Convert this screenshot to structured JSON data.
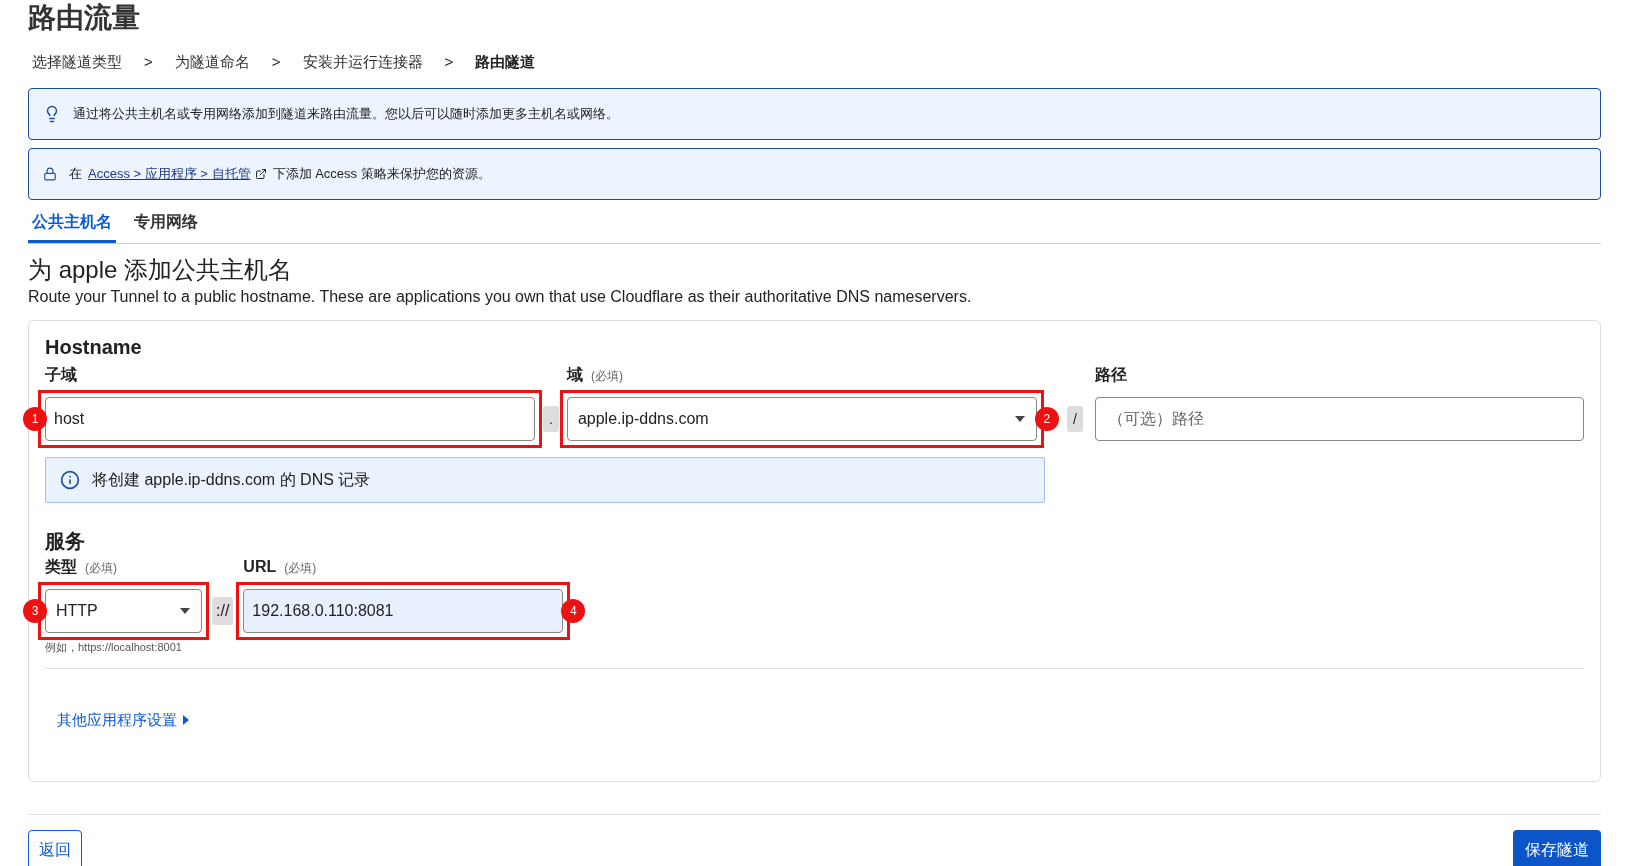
{
  "page_title": "路由流量",
  "breadcrumb": [
    {
      "label": "选择隧道类型",
      "selected": false
    },
    {
      "label": "为隧道命名",
      "selected": false
    },
    {
      "label": "安装并运行连接器",
      "selected": false
    },
    {
      "label": "路由隧道",
      "selected": true
    }
  ],
  "breadcrumb_separator": ">",
  "banners": [
    {
      "kind": "tip",
      "parts": [
        {
          "text": "通过将公共主机名或专用网络添加到隧道来路由流量。您以后可以随时添加更多主机名或网络。",
          "link": false
        }
      ]
    },
    {
      "kind": "lock",
      "parts": [
        {
          "text": "在",
          "link": false
        },
        {
          "text": "Access > 应用程序 > 自托管",
          "link": true
        },
        {
          "text": "下添加 Access 策略来保护您的资源。",
          "link": false
        }
      ]
    }
  ],
  "tabs": [
    {
      "label": "公共主机名",
      "selected": true
    },
    {
      "label": "专用网络",
      "selected": false
    }
  ],
  "heading": "为 apple 添加公共主机名",
  "description": "Route your Tunnel to a public hostname. These are applications you own that use Cloudflare as their authoritative DNS nameservers.",
  "hostname": {
    "title": "Hostname",
    "subdomain": {
      "label": "子域",
      "value": "host",
      "marker": "1"
    },
    "dot": ".",
    "domain": {
      "label": "域",
      "required": "(必填)",
      "value": "apple.ip-ddns.com",
      "marker": "2"
    },
    "slash": "/",
    "path": {
      "label": "路径",
      "placeholder": "（可选）路径"
    },
    "notice": "将创建 apple.ip-ddns.com 的 DNS 记录"
  },
  "service": {
    "title": "服务",
    "type": {
      "label": "类型",
      "required": "(必填)",
      "value": "HTTP",
      "marker": "3",
      "hint": "例如，https://localhost:8001"
    },
    "scheme_separator": "://",
    "url": {
      "label": "URL",
      "required": "(必填)",
      "value": "192.168.0.110:8081",
      "marker": "4"
    }
  },
  "more_settings": "其他应用程序设置",
  "buttons": {
    "back": "返回",
    "save": "保存隧道"
  }
}
